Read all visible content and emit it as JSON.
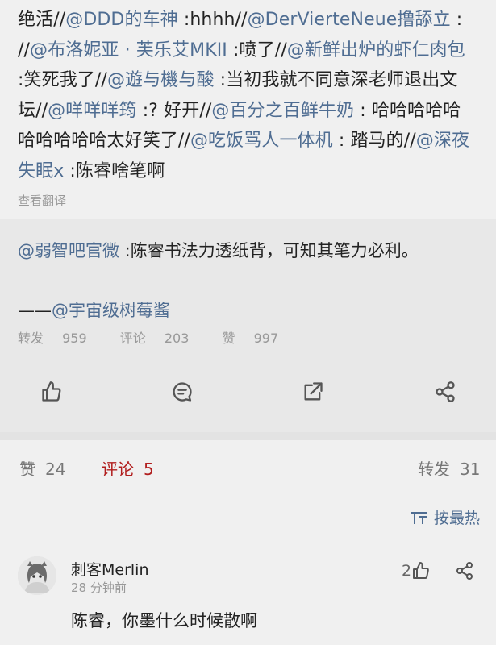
{
  "repost": {
    "segments": [
      {
        "t": "绝活//",
        "m": false
      },
      {
        "t": "@DDD的车神",
        "m": true
      },
      {
        "t": " :hhhh//",
        "m": false
      },
      {
        "t": "@DerVierteNeue撸舔立",
        "m": true
      },
      {
        "t": " : //",
        "m": false
      },
      {
        "t": "@布洛妮亚 · 芙乐艾MKII",
        "m": true
      },
      {
        "t": " :喷了//",
        "m": false
      },
      {
        "t": "@新鲜出炉的虾仁肉包",
        "m": true
      },
      {
        "t": " :笑死我了//",
        "m": false
      },
      {
        "t": "@遊与機与酸",
        "m": true
      },
      {
        "t": " :当初我就不同意深老师退出文坛//",
        "m": false
      },
      {
        "t": "@咩咩咩筠",
        "m": true
      },
      {
        "t": " :? 好开//",
        "m": false
      },
      {
        "t": "@百分之百鲜牛奶",
        "m": true
      },
      {
        "t": " : 哈哈哈哈哈哈哈哈哈哈太好笑了//",
        "m": false
      },
      {
        "t": "@吃饭骂人一体机",
        "m": true
      },
      {
        "t": " : 踏马的//",
        "m": false
      },
      {
        "t": "@深夜失眠x",
        "m": true
      },
      {
        "t": " :陈睿啥笔啊",
        "m": false
      }
    ],
    "translate_label": "查看翻译"
  },
  "quoted": {
    "author": "@弱智吧官微",
    "body": " :陈睿书法力透纸背，可知其笔力必利。",
    "sig_prefix": "——",
    "sig_mention": "@宇宙级树莓酱",
    "stats": {
      "repost_label": "转发",
      "repost_count": "959",
      "comment_label": "评论",
      "comment_count": "203",
      "like_label": "赞",
      "like_count": "997"
    }
  },
  "tabs": {
    "likes_label": "赞",
    "likes_count": "24",
    "comments_label": "评论",
    "comments_count": "5",
    "reposts_label": "转发",
    "reposts_count": "31"
  },
  "sort_label": "按最热",
  "comment": {
    "user": "刺客Merlin",
    "time": "28 分钟前",
    "text": "陈睿，你墨什么时候散啊",
    "likes": "2"
  },
  "colors": {
    "mention": "#4f6d92",
    "active_tab": "#b11e1e"
  }
}
